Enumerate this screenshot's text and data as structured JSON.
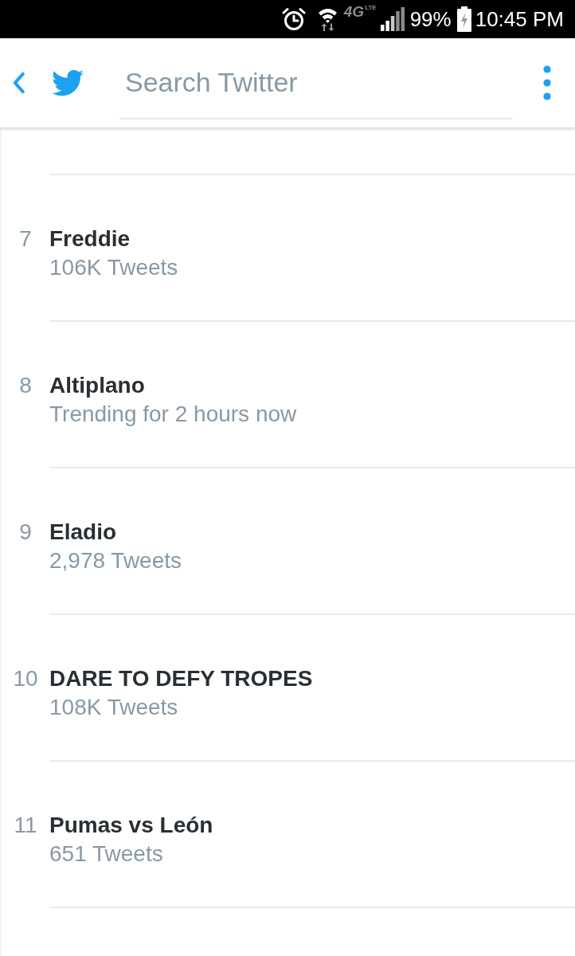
{
  "status_bar": {
    "network": "4G",
    "network_suffix": "LTE",
    "battery": "99%",
    "time": "10:45 PM"
  },
  "header": {
    "search": {
      "placeholder": "Search Twitter"
    }
  },
  "trends": [
    {
      "rank": "7",
      "name": "Freddie",
      "meta": "106K Tweets"
    },
    {
      "rank": "8",
      "name": "Altiplano",
      "meta": "Trending for 2 hours now"
    },
    {
      "rank": "9",
      "name": "Eladio",
      "meta": "2,978 Tweets"
    },
    {
      "rank": "10",
      "name": "DARE TO DEFY TROPES",
      "meta": "108K Tweets"
    },
    {
      "rank": "11",
      "name": "Pumas vs León",
      "meta": "651 Tweets"
    }
  ]
}
